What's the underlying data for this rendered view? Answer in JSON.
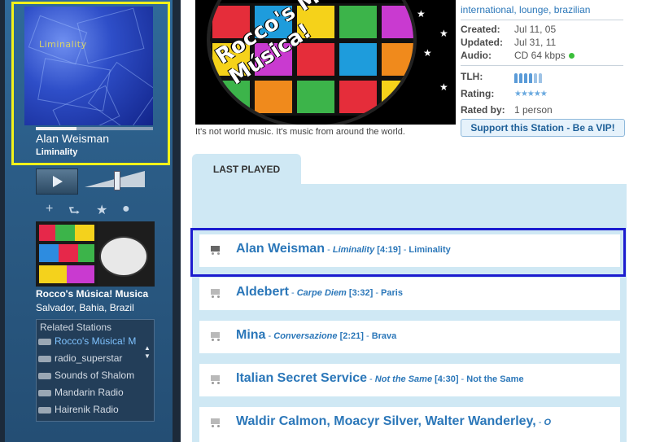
{
  "player": {
    "album_art_title": "Liminality",
    "track_artist": "Alan Weisman",
    "track_album": "Liminality",
    "progress": 0.35,
    "station_name": "Rocco's Música! Musica",
    "station_location": "Salvador, Bahia, Brazil",
    "related_title": "Related Stations",
    "related_stations": [
      "Rocco's Música! M",
      "radio_superstar",
      "Sounds of Shalom",
      "Mandarin Radio",
      "Hairenik Radio"
    ]
  },
  "banner": {
    "caption": "It's not world music. It's music from around the world.",
    "logo_text": "Rocco's Música! Música!"
  },
  "details": {
    "genres": "international, lounge, brazilian",
    "created_label": "Created:",
    "created_value": "Jul 11, 05",
    "updated_label": "Updated:",
    "updated_value": "Jul 31, 11",
    "audio_label": "Audio:",
    "audio_value": "CD 64 kbps",
    "tlh_label": "TLH:",
    "tlh_level": 4,
    "rating_label": "Rating:",
    "rating_stars": "★★★★★",
    "rated_by_label": "Rated by:",
    "rated_by_value": "1 person",
    "vip_button": "Support this Station - Be a VIP!"
  },
  "last_played": {
    "tab_label": "LAST PLAYED",
    "tracks": [
      {
        "artist": "Alan Weisman",
        "album": "Liminality",
        "duration": "[4:19]",
        "song": "Liminality"
      },
      {
        "artist": "Aldebert",
        "album": "Carpe Diem",
        "duration": "[3:32]",
        "song": "Paris"
      },
      {
        "artist": "Mina",
        "album": "Conversazione",
        "duration": "[2:21]",
        "song": "Brava"
      },
      {
        "artist": "Italian Secret Service",
        "album": "Not the Same",
        "duration": "[4:30]",
        "song": "Not the Same"
      },
      {
        "artist": "Waldir Calmon, Moacyr Silver, Walter Wanderley,",
        "album": "O",
        "duration": "",
        "song": ""
      }
    ]
  },
  "colors": {
    "link_blue": "#2b77b9",
    "panel_blue": "#cfe8f4",
    "highlight_yellow": "#f2f21a",
    "highlight_blue": "#1c1ccf"
  }
}
